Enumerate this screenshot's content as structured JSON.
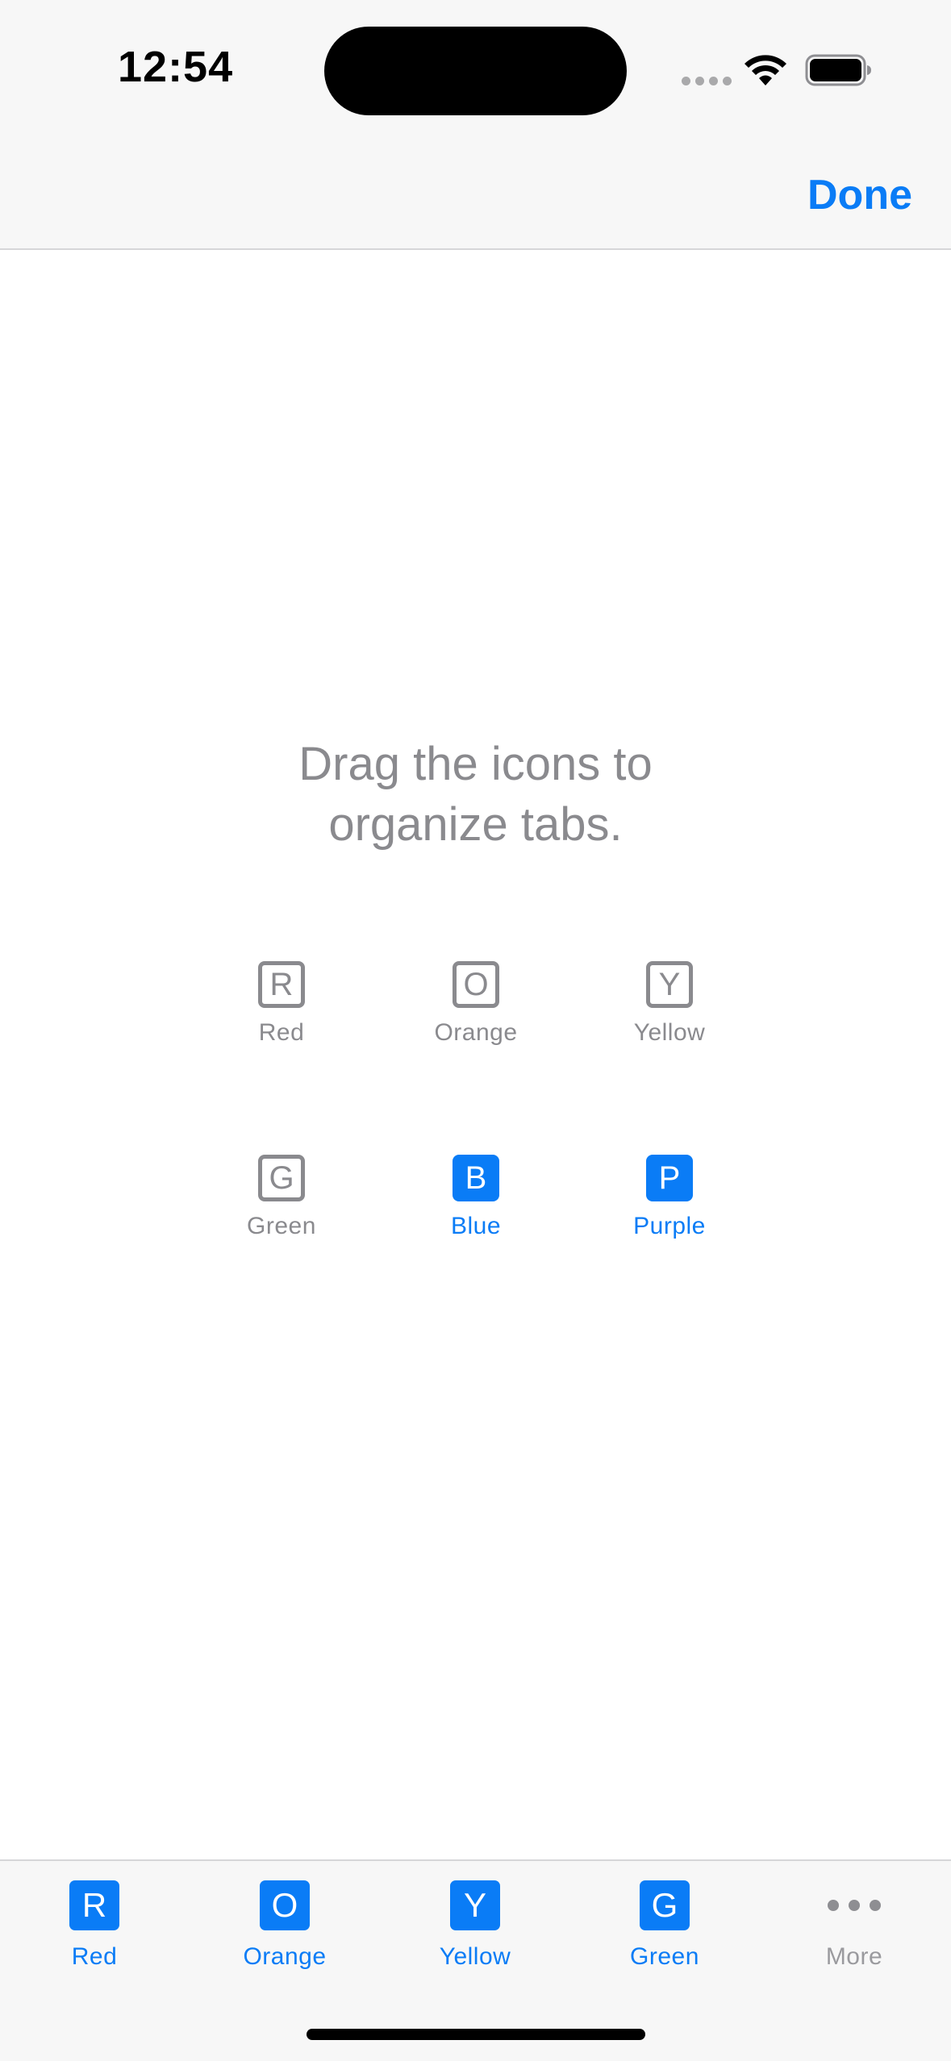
{
  "status_bar": {
    "time": "12:54"
  },
  "nav_bar": {
    "done_label": "Done"
  },
  "main": {
    "instruction_line1": "Drag the icons to",
    "instruction_line2": "organize tabs.",
    "items": [
      {
        "letter": "R",
        "label": "Red",
        "active": false
      },
      {
        "letter": "O",
        "label": "Orange",
        "active": false
      },
      {
        "letter": "Y",
        "label": "Yellow",
        "active": false
      },
      {
        "letter": "G",
        "label": "Green",
        "active": false
      },
      {
        "letter": "B",
        "label": "Blue",
        "active": true
      },
      {
        "letter": "P",
        "label": "Purple",
        "active": true
      }
    ]
  },
  "tab_bar": {
    "tabs": [
      {
        "letter": "R",
        "label": "Red"
      },
      {
        "letter": "O",
        "label": "Orange"
      },
      {
        "letter": "Y",
        "label": "Yellow"
      },
      {
        "letter": "G",
        "label": "Green"
      },
      {
        "icon": "more-icon",
        "label": "More"
      }
    ]
  },
  "colors": {
    "accent": "#0a7cf6",
    "inactive": "#8a8a8e",
    "bar_background": "#f7f7f7"
  }
}
